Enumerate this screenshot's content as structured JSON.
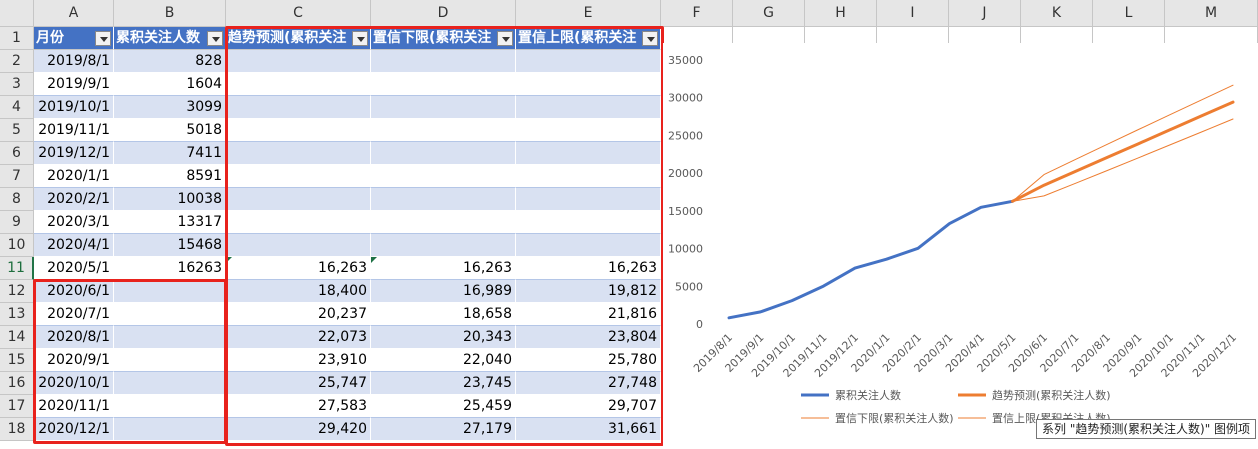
{
  "sheet": {
    "col_letters": [
      "A",
      "B",
      "C",
      "D",
      "E",
      "F",
      "G",
      "H",
      "I",
      "J",
      "K",
      "L",
      "M"
    ],
    "row_numbers": [
      "1",
      "2",
      "3",
      "4",
      "5",
      "6",
      "7",
      "8",
      "9",
      "10",
      "11",
      "12",
      "13",
      "14",
      "15",
      "16",
      "17",
      "18"
    ],
    "headers": [
      "月份",
      "累积关注人数",
      "趋势预测(累积关注",
      "置信下限(累积关注",
      "置信上限(累积关注"
    ],
    "rows": [
      [
        "2019/8/1",
        "828",
        "",
        "",
        ""
      ],
      [
        "2019/9/1",
        "1604",
        "",
        "",
        ""
      ],
      [
        "2019/10/1",
        "3099",
        "",
        "",
        ""
      ],
      [
        "2019/11/1",
        "5018",
        "",
        "",
        ""
      ],
      [
        "2019/12/1",
        "7411",
        "",
        "",
        ""
      ],
      [
        "2020/1/1",
        "8591",
        "",
        "",
        ""
      ],
      [
        "2020/2/1",
        "10038",
        "",
        "",
        ""
      ],
      [
        "2020/3/1",
        "13317",
        "",
        "",
        ""
      ],
      [
        "2020/4/1",
        "15468",
        "",
        "",
        ""
      ],
      [
        "2020/5/1",
        "16263",
        "16,263",
        "16,263",
        "16,263"
      ],
      [
        "2020/6/1",
        "",
        "18,400",
        "16,989",
        "19,812"
      ],
      [
        "2020/7/1",
        "",
        "20,237",
        "18,658",
        "21,816"
      ],
      [
        "2020/8/1",
        "",
        "22,073",
        "20,343",
        "23,804"
      ],
      [
        "2020/9/1",
        "",
        "23,910",
        "22,040",
        "25,780"
      ],
      [
        "2020/10/1",
        "",
        "25,747",
        "23,745",
        "27,748"
      ],
      [
        "2020/11/1",
        "",
        "27,583",
        "25,459",
        "29,707"
      ],
      [
        "2020/12/1",
        "",
        "29,420",
        "27,179",
        "31,661"
      ]
    ]
  },
  "chart_data": {
    "type": "line",
    "categories": [
      "2019/8/1",
      "2019/9/1",
      "2019/10/1",
      "2019/11/1",
      "2019/12/1",
      "2020/1/1",
      "2020/2/1",
      "2020/3/1",
      "2020/4/1",
      "2020/5/1",
      "2020/6/1",
      "2020/7/1",
      "2020/8/1",
      "2020/9/1",
      "2020/10/1",
      "2020/11/1",
      "2020/12/1"
    ],
    "y_ticks": [
      "35000",
      "30000",
      "25000",
      "20000",
      "15000",
      "10000",
      "5000",
      "0"
    ],
    "ylim": [
      0,
      35000
    ],
    "series": [
      {
        "name": "累积关注人数",
        "color": "#4472c4",
        "values": [
          828,
          1604,
          3099,
          5018,
          7411,
          8591,
          10038,
          13317,
          15468,
          16263,
          null,
          null,
          null,
          null,
          null,
          null,
          null
        ]
      },
      {
        "name": "趋势预测(累积关注人数)",
        "color": "#ed7d31",
        "values": [
          null,
          null,
          null,
          null,
          null,
          null,
          null,
          null,
          null,
          16263,
          18400,
          20237,
          22073,
          23910,
          25747,
          27583,
          29420
        ]
      },
      {
        "name": "置信下限(累积关注人数)",
        "color": "#ed7d31",
        "values": [
          null,
          null,
          null,
          null,
          null,
          null,
          null,
          null,
          null,
          16263,
          16989,
          18658,
          20343,
          22040,
          23745,
          25459,
          27179
        ]
      },
      {
        "name": "置信上限(累积关注人数)",
        "color": "#ed7d31",
        "values": [
          null,
          null,
          null,
          null,
          null,
          null,
          null,
          null,
          null,
          16263,
          19812,
          21816,
          23804,
          25780,
          27748,
          29707,
          31661
        ]
      }
    ],
    "legend": "bottom",
    "grid": false
  },
  "tooltip": "系列 \"趋势预测(累积关注人数)\" 图例项"
}
